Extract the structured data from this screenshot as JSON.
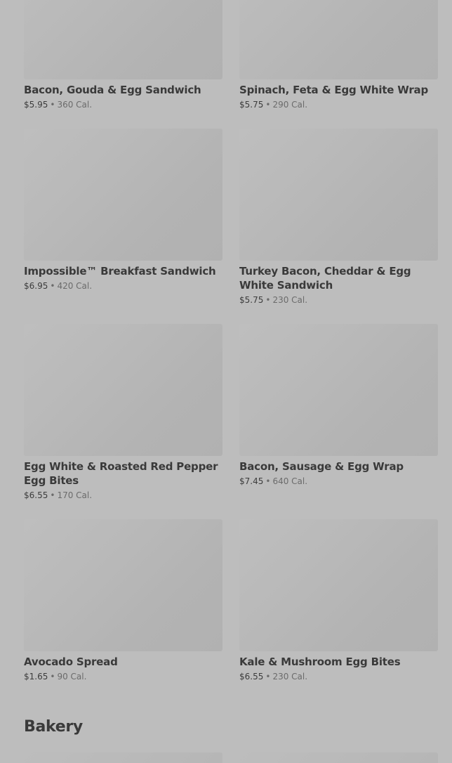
{
  "items": [
    {
      "name": "Bacon, Gouda & Egg Sandwich",
      "price": "$5.95",
      "calories": "360 Cal."
    },
    {
      "name": "Spinach, Feta & Egg White Wrap",
      "price": "$5.75",
      "calories": "290 Cal."
    },
    {
      "name": "Impossible™ Breakfast Sandwich",
      "price": "$6.95",
      "calories": "420 Cal."
    },
    {
      "name": "Turkey Bacon, Cheddar & Egg White Sandwich",
      "price": "$5.75",
      "calories": "230 Cal."
    },
    {
      "name": "Egg White & Roasted Red Pepper Egg Bites",
      "price": "$6.55",
      "calories": "170 Cal."
    },
    {
      "name": "Bacon, Sausage & Egg Wrap",
      "price": "$7.45",
      "calories": "640 Cal."
    },
    {
      "name": "Avocado Spread",
      "price": "$1.65",
      "calories": "90 Cal."
    },
    {
      "name": "Kale & Mushroom Egg Bites",
      "price": "$6.55",
      "calories": "230 Cal."
    }
  ],
  "separator": "•",
  "section": {
    "title": "Bakery"
  }
}
